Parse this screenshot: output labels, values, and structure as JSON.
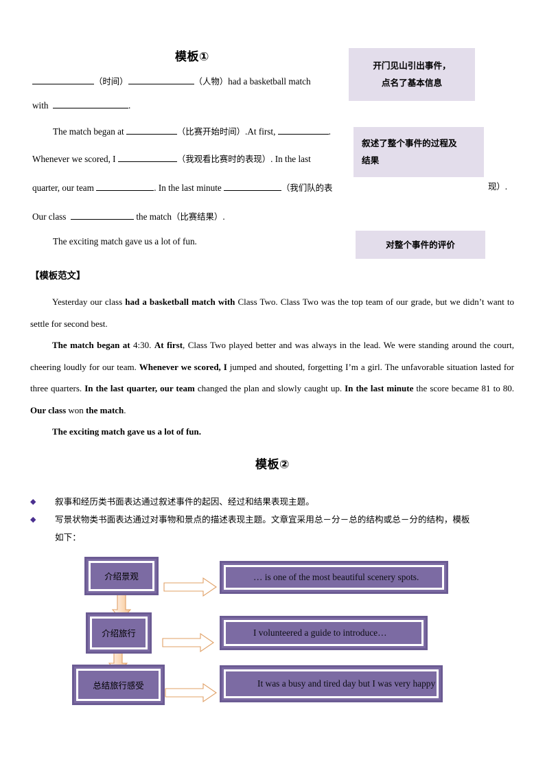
{
  "document": {
    "template1": {
      "title": "模板①",
      "lines": [
        {
          "id": "l1",
          "segments": "（时间）　　（人物）had a basketball match"
        }
      ],
      "text": {
        "paren_time": "（时间）",
        "paren_person": "（人物）",
        "had_match": "had a  basketball  match",
        "with_word": "with",
        "period": ".",
        "match_began": "The match began at",
        "paren_start_time": "（比赛开始时间）",
        "at_first": ".At first,",
        "whenever": "Whenever  we  scored,  I",
        "paren_my_behavior": "（我观看比赛时的表现）",
        "in_the_last": ". In the  last",
        "quarter_our_team": "quarter, our team",
        "in_last_minute": ". In the last minute",
        "paren_our_team_perf_a": "（我们队的表",
        "paren_our_team_perf_b": "现）",
        "our_class": "Our class",
        "the_match": "the match",
        "paren_result": "（比赛结果）",
        "closing": "The exciting match gave us a lot of fun."
      },
      "callouts": [
        {
          "id": "callout-1",
          "line1": "开门见山引出事件，",
          "line2": "点名了基本信息"
        },
        {
          "id": "callout-2",
          "line1": "叙述了整个事件的过程及",
          "line2": "结果"
        },
        {
          "id": "callout-3",
          "line1": "对整个事件的评价",
          "line2": ""
        }
      ]
    },
    "sample": {
      "heading": "【模板范文】",
      "paragraphs": [
        {
          "id": "p1",
          "runs": [
            {
              "t": "Yesterday our class ",
              "b": false
            },
            {
              "t": "had a basketball match with",
              "b": true
            },
            {
              "t": " Class Two. Class Two was the top team of our grade, but we didn’t want to settle for second best.",
              "b": false
            }
          ]
        },
        {
          "id": "p2",
          "runs": [
            {
              "t": "The match began at",
              "b": true
            },
            {
              "t": " 4:30. ",
              "b": false
            },
            {
              "t": "At first",
              "b": true
            },
            {
              "t": ", Class Two played better and was always in the lead. We were standing around the court, cheering loudly for our team. ",
              "b": false
            },
            {
              "t": "Whenever we scored, I",
              "b": true
            },
            {
              "t": " jumped and shouted, forgetting I’m a girl. The unfavorable situation lasted for three quarters. ",
              "b": false
            },
            {
              "t": "In the last quarter, our team",
              "b": true
            },
            {
              "t": " changed the plan and slowly caught up. ",
              "b": false
            },
            {
              "t": "In the last minute",
              "b": true
            },
            {
              "t": " the score became 81 to 80. ",
              "b": false
            },
            {
              "t": "Our class",
              "b": true
            },
            {
              "t": " won ",
              "b": false
            },
            {
              "t": "the match",
              "b": true
            },
            {
              "t": ".",
              "b": false
            }
          ]
        },
        {
          "id": "p3",
          "runs": [
            {
              "t": "The exciting match gave us a lot of fun.",
              "b": true
            }
          ]
        }
      ]
    },
    "template2": {
      "title": "模板②",
      "bullets": [
        {
          "id": "b1",
          "marker": "◆",
          "text": "叙事和经历类书面表达通过叙述事件的起因、经过和结果表现主题。"
        },
        {
          "id": "b2",
          "marker": "◆",
          "text": "写景状物类书面表达通过对事物和景点的描述表现主题。文章宜采用总－分－总的结构或总－分的结构，模板"
        },
        {
          "id": "b3",
          "marker": "",
          "text": "如下："
        }
      ],
      "flowchart": {
        "stages": [
          {
            "id": "stage-1",
            "label": "介绍景观",
            "example": "… is one of the most beautiful scenery spots."
          },
          {
            "id": "stage-2",
            "label": "介绍旅行",
            "example": "I volunteered a guide to introduce…"
          },
          {
            "id": "stage-3",
            "label": "总结旅行感受",
            "example": "It was a busy and tired day but I was very happy"
          }
        ],
        "arrows": {
          "right": "right-arrow-icon",
          "down": "down-arrow-icon"
        }
      }
    }
  },
  "colors": {
    "callout_bg": "#e3ddeb",
    "flow_fill": "#7c6ba3",
    "flow_border": "#6b5b93",
    "flow_inner": "#ffffff",
    "arrow_fill": "#fbdcbe",
    "arrow_stroke": "#e9a66a",
    "bullet": "#4a2f8f"
  }
}
